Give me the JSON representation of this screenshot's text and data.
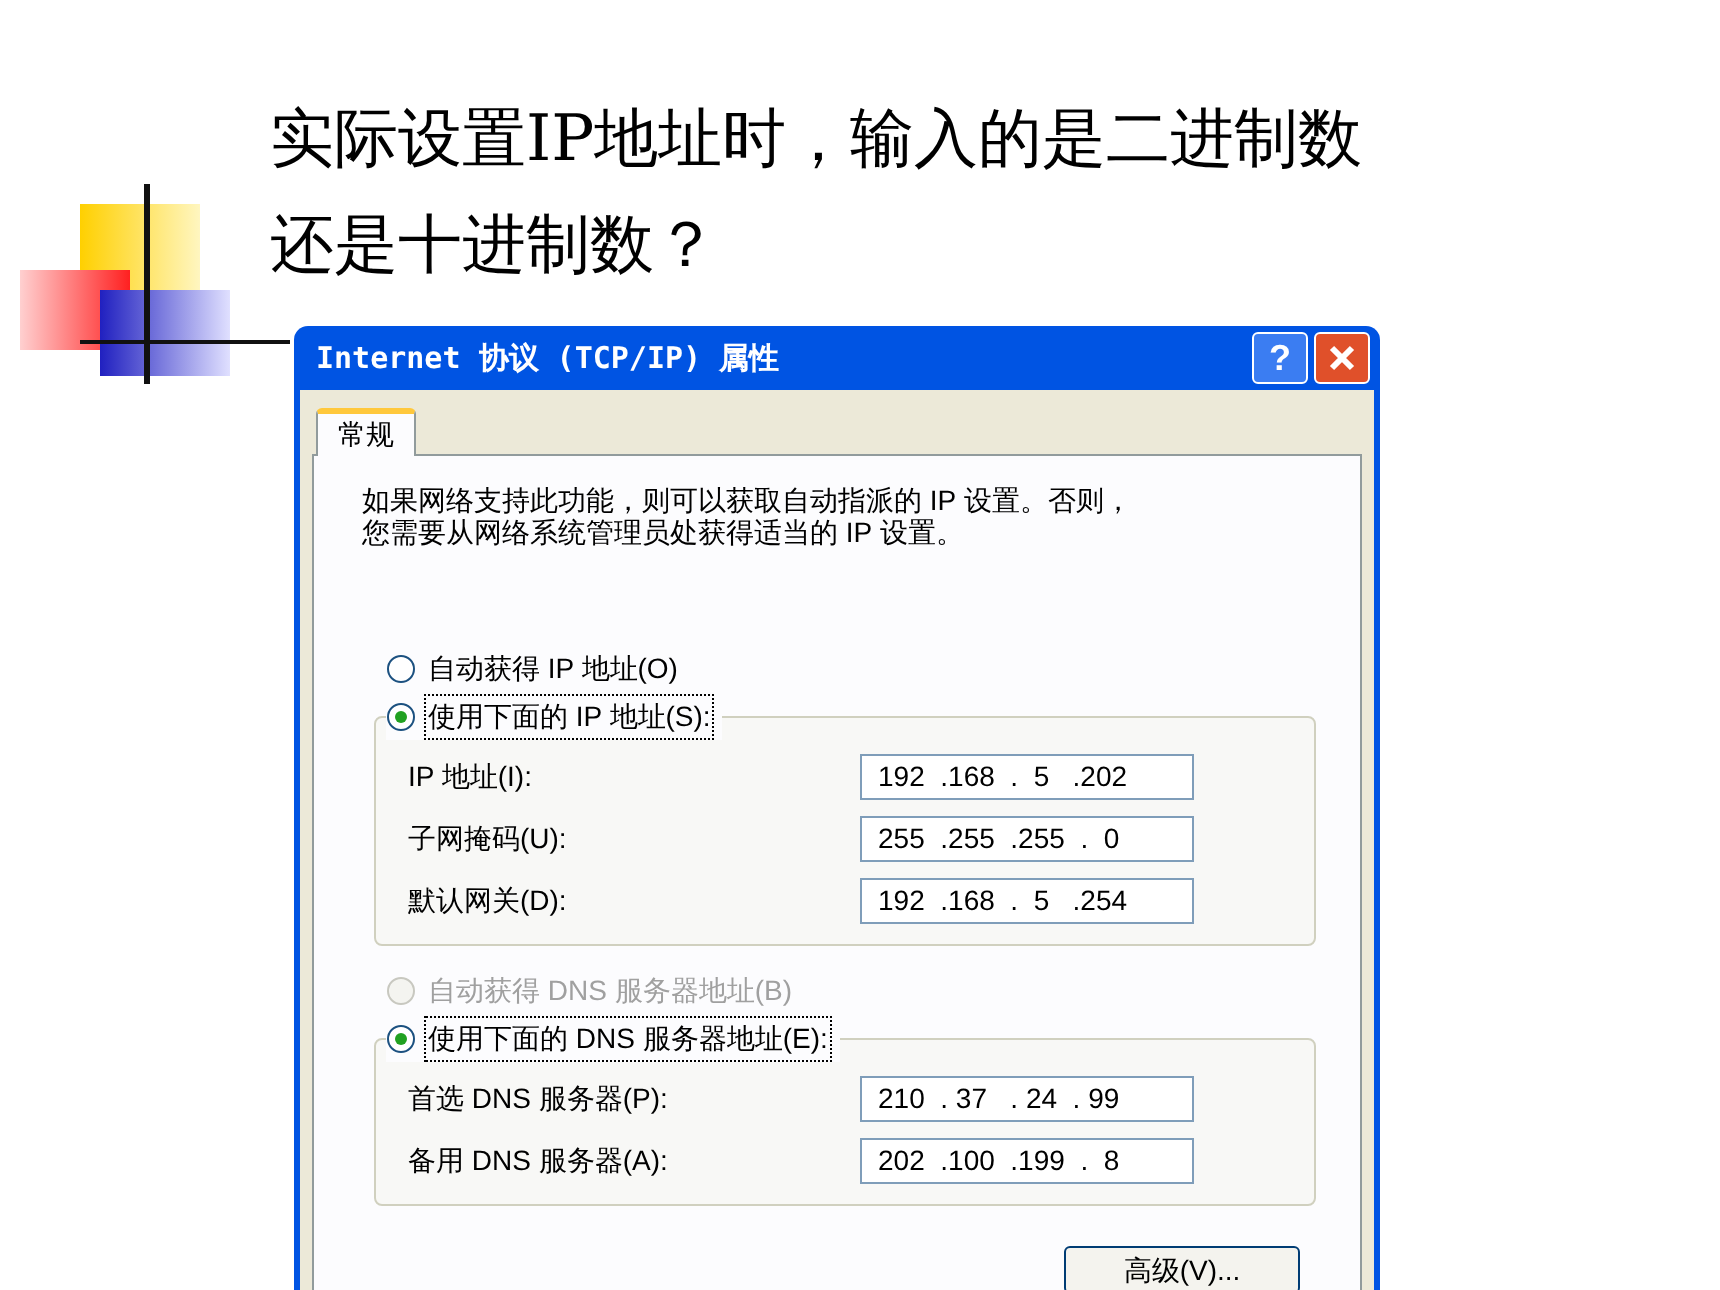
{
  "slide": {
    "title_lines": [
      "实际设置IP地址时，输入的是二进制数",
      "还是十进制数？"
    ]
  },
  "dialog": {
    "title": "Internet 协议 (TCP/IP) 属性",
    "help_button": "?",
    "tabs": [
      {
        "label": "常规",
        "selected": true
      }
    ],
    "description_lines": [
      "如果网络支持此功能，则可以获取自动指派的 IP 设置。否则，",
      "您需要从网络系统管理员处获得适当的 IP 设置。"
    ],
    "ip_options": [
      {
        "label": "自动获得 IP 地址(O)",
        "selected": false,
        "disabled": false
      },
      {
        "label": "使用下面的 IP 地址(S):",
        "selected": true,
        "disabled": false
      }
    ],
    "ip_fields": [
      {
        "label": "IP 地址(I):",
        "value": "192  .168  .  5   .202"
      },
      {
        "label": "子网掩码(U):",
        "value": "255  .255  .255  .  0"
      },
      {
        "label": "默认网关(D):",
        "value": "192  .168  .  5   .254"
      }
    ],
    "dns_options": [
      {
        "label": "自动获得 DNS 服务器地址(B)",
        "selected": false,
        "disabled": true
      },
      {
        "label": "使用下面的 DNS 服务器地址(E):",
        "selected": true,
        "disabled": false
      }
    ],
    "dns_fields": [
      {
        "label": "首选 DNS 服务器(P):",
        "value": "210  . 37   . 24  . 99"
      },
      {
        "label": "备用 DNS 服务器(A):",
        "value": "202  .100  .199  .  8"
      }
    ],
    "advanced_button": "高级(V)..."
  }
}
